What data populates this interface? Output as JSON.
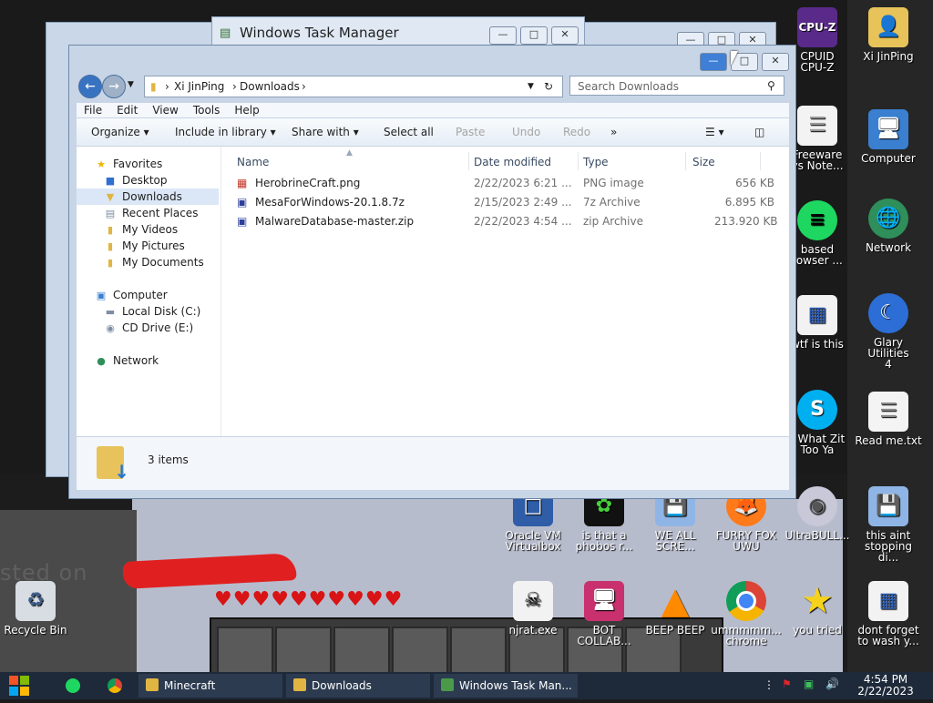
{
  "colors": {
    "accent": "#2b6fbf",
    "selection": "#dbe7f6",
    "taskbar": "#1e2a3a"
  },
  "desktop": {
    "background_text": "sted on",
    "icons_right_col": [
      {
        "label": "Xi JinPing",
        "icon": "user-folder-icon"
      },
      {
        "label": "Computer",
        "icon": "computer-icon"
      },
      {
        "label": "Network",
        "icon": "network-icon"
      },
      {
        "label": "Glary Utilities\n4",
        "icon": "glary-icon"
      },
      {
        "label": "Read me.txt",
        "icon": "text-file-icon"
      },
      {
        "label": "this aint\nstopping di...",
        "icon": "installer-icon"
      },
      {
        "label": "dont forget\nto wash y...",
        "icon": "calendar-file-icon"
      }
    ],
    "icons_second_col": [
      {
        "label": "CPUID\nCPU-Z",
        "icon": "cpuz-icon"
      },
      {
        "label": "Freeware\nys Note...",
        "icon": "document-icon"
      },
      {
        "label": "based\nrowser ...",
        "icon": "spotify-icon"
      },
      {
        "label": "wtf is this",
        "icon": "calendar-file-icon"
      },
      {
        "label": "r What Zit\nToo Ya",
        "icon": "skype-icon"
      },
      {
        "label": "UltraBULL...",
        "icon": "disc-icon"
      },
      {
        "label": "you tried",
        "icon": "star-icon"
      }
    ],
    "icons_bottom_row1": [
      {
        "label": "Oracle VM\nVirtualbox",
        "icon": "virtualbox-icon"
      },
      {
        "label": "is that a\nphobos r...",
        "icon": "flower-icon"
      },
      {
        "label": "WE ALL\nSCRE...",
        "icon": "installer-icon"
      },
      {
        "label": "FURRY FOX\nUWU",
        "icon": "firefox-icon"
      }
    ],
    "icons_bottom_row2": [
      {
        "label": "njrat.exe",
        "icon": "skull-icon"
      },
      {
        "label": "BOT\nCOLLAB...",
        "icon": "monitor-icon"
      },
      {
        "label": "BEEP BEEP",
        "icon": "vlc-icon"
      },
      {
        "label": "ummmmm...\nchrome",
        "icon": "chrome-icon"
      }
    ],
    "recycle_bin": "Recycle Bin"
  },
  "task_manager": {
    "title": "Windows Task Manager"
  },
  "explorer": {
    "breadcrumb": [
      "Xi JinPing",
      "Downloads"
    ],
    "search_placeholder": "Search Downloads",
    "menu": [
      "File",
      "Edit",
      "View",
      "Tools",
      "Help"
    ],
    "toolbar": {
      "organize": "Organize",
      "include": "Include in library",
      "share": "Share with",
      "select_all": "Select all",
      "paste": "Paste",
      "undo": "Undo",
      "redo": "Redo",
      "more": "»"
    },
    "nav": {
      "favorites": "Favorites",
      "desktop": "Desktop",
      "downloads": "Downloads",
      "recent": "Recent Places",
      "videos": "My Videos",
      "pictures": "My Pictures",
      "documents": "My Documents",
      "computer": "Computer",
      "local_disk": "Local Disk (C:)",
      "cd_drive": "CD Drive (E:)",
      "network": "Network"
    },
    "columns": {
      "name": "Name",
      "date": "Date modified",
      "type": "Type",
      "size": "Size"
    },
    "files": [
      {
        "name": "HerobrineCraft.png",
        "date": "2/22/2023 6:21 ...",
        "type": "PNG image",
        "size": "656 KB",
        "icon": "image-file-icon"
      },
      {
        "name": "MesaForWindows-20.1.8.7z",
        "date": "2/15/2023 2:49 ...",
        "type": "7z Archive",
        "size": "6.895 KB",
        "icon": "archive-icon"
      },
      {
        "name": "MalwareDatabase-master.zip",
        "date": "2/22/2023 4:54 ...",
        "type": "zip Archive",
        "size": "213.920 KB",
        "icon": "archive-icon"
      }
    ],
    "status": "3 items"
  },
  "taskbar": {
    "apps": [
      {
        "label": "Minecraft"
      },
      {
        "label": "Downloads"
      },
      {
        "label": "Windows Task Man..."
      }
    ],
    "time": "4:54 PM",
    "date": "2/22/2023"
  }
}
